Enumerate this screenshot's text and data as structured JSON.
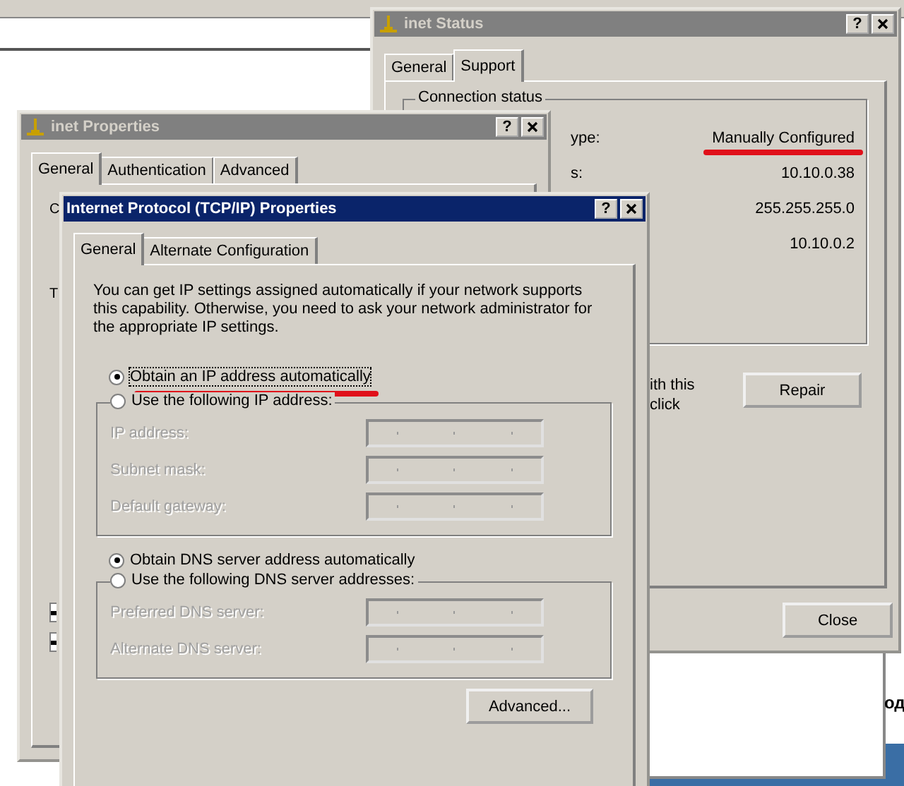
{
  "desktop": {
    "fragments": [
      "од"
    ]
  },
  "status_window": {
    "title": "inet Status",
    "help_button": "?",
    "tabs": [
      {
        "label": "General",
        "selected": false
      },
      {
        "label": "Support",
        "selected": true
      }
    ],
    "group_label": "Connection status",
    "rows": [
      {
        "label": "ype:",
        "value": "Manually Configured",
        "highlighted": true
      },
      {
        "label": "s:",
        "value": "10.10.0.38",
        "highlighted": false
      },
      {
        "value": "255.255.255.0",
        "highlighted": false
      },
      {
        "value": "10.10.0.2",
        "highlighted": false
      }
    ],
    "repair_text": "ith this\nclick",
    "repair_button": "Repair",
    "close_button": "Close"
  },
  "properties_window": {
    "title": "inet Properties",
    "help_button": "?",
    "tabs": [
      {
        "label": "General",
        "selected": true
      },
      {
        "label": "Authentication",
        "selected": false
      },
      {
        "label": "Advanced",
        "selected": false
      }
    ],
    "fragments": [
      "C",
      "T"
    ],
    "checkboxes": [
      {
        "checked": true
      },
      {
        "checked": true
      }
    ]
  },
  "tcpip_window": {
    "title": "Internet Protocol (TCP/IP) Properties",
    "help_button": "?",
    "tabs": [
      {
        "label": "General",
        "selected": true
      },
      {
        "label": "Alternate Configuration",
        "selected": false
      }
    ],
    "description": "You can get IP settings assigned automatically if your network supports this capability. Otherwise, you need to ask your network administrator for the appropriate IP settings.",
    "ip_options": [
      {
        "label": "Obtain an IP address automatically",
        "selected": true,
        "highlighted": true
      },
      {
        "label": "Use the following IP address:",
        "selected": false,
        "highlighted": false
      }
    ],
    "ip_fields": [
      {
        "label": "IP address:",
        "disabled": true
      },
      {
        "label": "Subnet mask:",
        "disabled": true
      },
      {
        "label": "Default gateway:",
        "disabled": true
      }
    ],
    "dns_options": [
      {
        "label": "Obtain DNS server address automatically",
        "selected": true,
        "highlighted": false
      },
      {
        "label": "Use the following DNS server addresses:",
        "selected": false,
        "highlighted": false
      }
    ],
    "dns_fields": [
      {
        "label": "Preferred DNS server:",
        "disabled": true
      },
      {
        "label": "Alternate DNS server:",
        "disabled": true
      }
    ],
    "advanced_button": "Advanced..."
  }
}
